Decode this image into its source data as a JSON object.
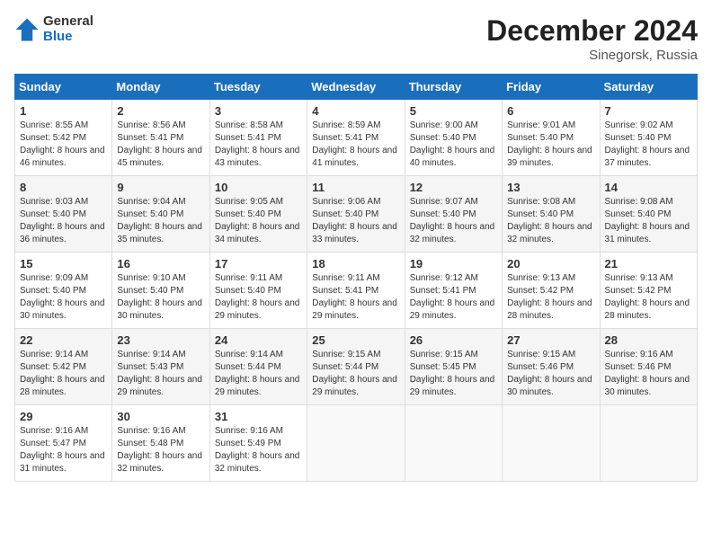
{
  "header": {
    "logo_general": "General",
    "logo_blue": "Blue",
    "month_title": "December 2024",
    "location": "Sinegorsk, Russia"
  },
  "weekdays": [
    "Sunday",
    "Monday",
    "Tuesday",
    "Wednesday",
    "Thursday",
    "Friday",
    "Saturday"
  ],
  "weeks": [
    [
      {
        "day": "1",
        "sunrise": "Sunrise: 8:55 AM",
        "sunset": "Sunset: 5:42 PM",
        "daylight": "Daylight: 8 hours and 46 minutes."
      },
      {
        "day": "2",
        "sunrise": "Sunrise: 8:56 AM",
        "sunset": "Sunset: 5:41 PM",
        "daylight": "Daylight: 8 hours and 45 minutes."
      },
      {
        "day": "3",
        "sunrise": "Sunrise: 8:58 AM",
        "sunset": "Sunset: 5:41 PM",
        "daylight": "Daylight: 8 hours and 43 minutes."
      },
      {
        "day": "4",
        "sunrise": "Sunrise: 8:59 AM",
        "sunset": "Sunset: 5:41 PM",
        "daylight": "Daylight: 8 hours and 41 minutes."
      },
      {
        "day": "5",
        "sunrise": "Sunrise: 9:00 AM",
        "sunset": "Sunset: 5:40 PM",
        "daylight": "Daylight: 8 hours and 40 minutes."
      },
      {
        "day": "6",
        "sunrise": "Sunrise: 9:01 AM",
        "sunset": "Sunset: 5:40 PM",
        "daylight": "Daylight: 8 hours and 39 minutes."
      },
      {
        "day": "7",
        "sunrise": "Sunrise: 9:02 AM",
        "sunset": "Sunset: 5:40 PM",
        "daylight": "Daylight: 8 hours and 37 minutes."
      }
    ],
    [
      {
        "day": "8",
        "sunrise": "Sunrise: 9:03 AM",
        "sunset": "Sunset: 5:40 PM",
        "daylight": "Daylight: 8 hours and 36 minutes."
      },
      {
        "day": "9",
        "sunrise": "Sunrise: 9:04 AM",
        "sunset": "Sunset: 5:40 PM",
        "daylight": "Daylight: 8 hours and 35 minutes."
      },
      {
        "day": "10",
        "sunrise": "Sunrise: 9:05 AM",
        "sunset": "Sunset: 5:40 PM",
        "daylight": "Daylight: 8 hours and 34 minutes."
      },
      {
        "day": "11",
        "sunrise": "Sunrise: 9:06 AM",
        "sunset": "Sunset: 5:40 PM",
        "daylight": "Daylight: 8 hours and 33 minutes."
      },
      {
        "day": "12",
        "sunrise": "Sunrise: 9:07 AM",
        "sunset": "Sunset: 5:40 PM",
        "daylight": "Daylight: 8 hours and 32 minutes."
      },
      {
        "day": "13",
        "sunrise": "Sunrise: 9:08 AM",
        "sunset": "Sunset: 5:40 PM",
        "daylight": "Daylight: 8 hours and 32 minutes."
      },
      {
        "day": "14",
        "sunrise": "Sunrise: 9:08 AM",
        "sunset": "Sunset: 5:40 PM",
        "daylight": "Daylight: 8 hours and 31 minutes."
      }
    ],
    [
      {
        "day": "15",
        "sunrise": "Sunrise: 9:09 AM",
        "sunset": "Sunset: 5:40 PM",
        "daylight": "Daylight: 8 hours and 30 minutes."
      },
      {
        "day": "16",
        "sunrise": "Sunrise: 9:10 AM",
        "sunset": "Sunset: 5:40 PM",
        "daylight": "Daylight: 8 hours and 30 minutes."
      },
      {
        "day": "17",
        "sunrise": "Sunrise: 9:11 AM",
        "sunset": "Sunset: 5:40 PM",
        "daylight": "Daylight: 8 hours and 29 minutes."
      },
      {
        "day": "18",
        "sunrise": "Sunrise: 9:11 AM",
        "sunset": "Sunset: 5:41 PM",
        "daylight": "Daylight: 8 hours and 29 minutes."
      },
      {
        "day": "19",
        "sunrise": "Sunrise: 9:12 AM",
        "sunset": "Sunset: 5:41 PM",
        "daylight": "Daylight: 8 hours and 29 minutes."
      },
      {
        "day": "20",
        "sunrise": "Sunrise: 9:13 AM",
        "sunset": "Sunset: 5:42 PM",
        "daylight": "Daylight: 8 hours and 28 minutes."
      },
      {
        "day": "21",
        "sunrise": "Sunrise: 9:13 AM",
        "sunset": "Sunset: 5:42 PM",
        "daylight": "Daylight: 8 hours and 28 minutes."
      }
    ],
    [
      {
        "day": "22",
        "sunrise": "Sunrise: 9:14 AM",
        "sunset": "Sunset: 5:42 PM",
        "daylight": "Daylight: 8 hours and 28 minutes."
      },
      {
        "day": "23",
        "sunrise": "Sunrise: 9:14 AM",
        "sunset": "Sunset: 5:43 PM",
        "daylight": "Daylight: 8 hours and 29 minutes."
      },
      {
        "day": "24",
        "sunrise": "Sunrise: 9:14 AM",
        "sunset": "Sunset: 5:44 PM",
        "daylight": "Daylight: 8 hours and 29 minutes."
      },
      {
        "day": "25",
        "sunrise": "Sunrise: 9:15 AM",
        "sunset": "Sunset: 5:44 PM",
        "daylight": "Daylight: 8 hours and 29 minutes."
      },
      {
        "day": "26",
        "sunrise": "Sunrise: 9:15 AM",
        "sunset": "Sunset: 5:45 PM",
        "daylight": "Daylight: 8 hours and 29 minutes."
      },
      {
        "day": "27",
        "sunrise": "Sunrise: 9:15 AM",
        "sunset": "Sunset: 5:46 PM",
        "daylight": "Daylight: 8 hours and 30 minutes."
      },
      {
        "day": "28",
        "sunrise": "Sunrise: 9:16 AM",
        "sunset": "Sunset: 5:46 PM",
        "daylight": "Daylight: 8 hours and 30 minutes."
      }
    ],
    [
      {
        "day": "29",
        "sunrise": "Sunrise: 9:16 AM",
        "sunset": "Sunset: 5:47 PM",
        "daylight": "Daylight: 8 hours and 31 minutes."
      },
      {
        "day": "30",
        "sunrise": "Sunrise: 9:16 AM",
        "sunset": "Sunset: 5:48 PM",
        "daylight": "Daylight: 8 hours and 32 minutes."
      },
      {
        "day": "31",
        "sunrise": "Sunrise: 9:16 AM",
        "sunset": "Sunset: 5:49 PM",
        "daylight": "Daylight: 8 hours and 32 minutes."
      },
      null,
      null,
      null,
      null
    ]
  ]
}
